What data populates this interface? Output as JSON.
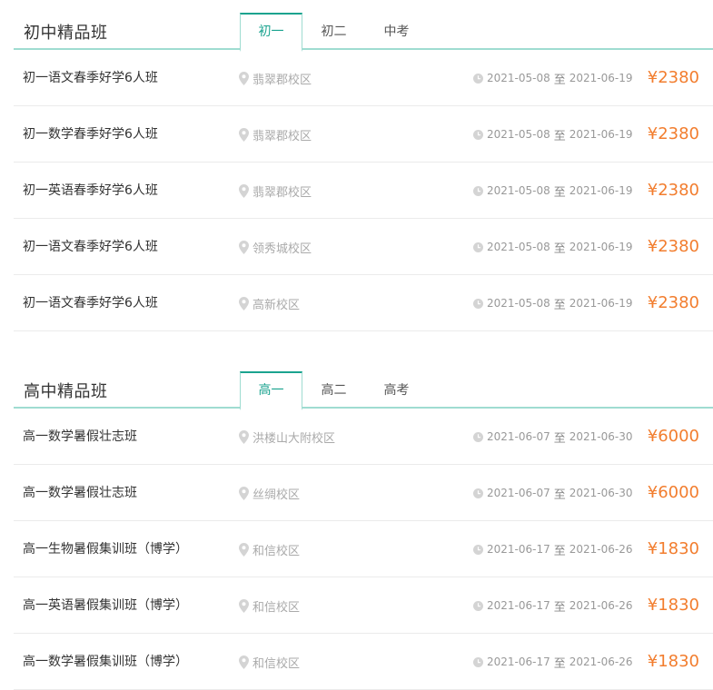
{
  "colors": {
    "accent": "#1aa38f",
    "tab_border": "#9fdcd1",
    "price": "#f27d2e",
    "muted": "#aaaaaa"
  },
  "icons": {
    "location": "map-pin-icon",
    "time": "clock-icon"
  },
  "date_separator": "至",
  "currency": "¥",
  "sections": [
    {
      "title": "初中精品班",
      "tabs": [
        {
          "label": "初一",
          "active": true
        },
        {
          "label": "初二",
          "active": false
        },
        {
          "label": "中考",
          "active": false
        }
      ],
      "rows": [
        {
          "name": "初一语文春季好学6人班",
          "location": "翡翠郡校区",
          "start": "2021-05-08",
          "end": "2021-06-19",
          "price": "2380"
        },
        {
          "name": "初一数学春季好学6人班",
          "location": "翡翠郡校区",
          "start": "2021-05-08",
          "end": "2021-06-19",
          "price": "2380"
        },
        {
          "name": "初一英语春季好学6人班",
          "location": "翡翠郡校区",
          "start": "2021-05-08",
          "end": "2021-06-19",
          "price": "2380"
        },
        {
          "name": "初一语文春季好学6人班",
          "location": "领秀城校区",
          "start": "2021-05-08",
          "end": "2021-06-19",
          "price": "2380"
        },
        {
          "name": "初一语文春季好学6人班",
          "location": "高新校区",
          "start": "2021-05-08",
          "end": "2021-06-19",
          "price": "2380"
        }
      ]
    },
    {
      "title": "高中精品班",
      "tabs": [
        {
          "label": "高一",
          "active": true
        },
        {
          "label": "高二",
          "active": false
        },
        {
          "label": "高考",
          "active": false
        }
      ],
      "rows": [
        {
          "name": "高一数学暑假壮志班",
          "location": "洪楼山大附校区",
          "start": "2021-06-07",
          "end": "2021-06-30",
          "price": "6000"
        },
        {
          "name": "高一数学暑假壮志班",
          "location": "丝绸校区",
          "start": "2021-06-07",
          "end": "2021-06-30",
          "price": "6000"
        },
        {
          "name": "高一生物暑假集训班（博学）",
          "location": "和信校区",
          "start": "2021-06-17",
          "end": "2021-06-26",
          "price": "1830"
        },
        {
          "name": "高一英语暑假集训班（博学）",
          "location": "和信校区",
          "start": "2021-06-17",
          "end": "2021-06-26",
          "price": "1830"
        },
        {
          "name": "高一数学暑假集训班（博学）",
          "location": "和信校区",
          "start": "2021-06-17",
          "end": "2021-06-26",
          "price": "1830"
        }
      ]
    }
  ]
}
